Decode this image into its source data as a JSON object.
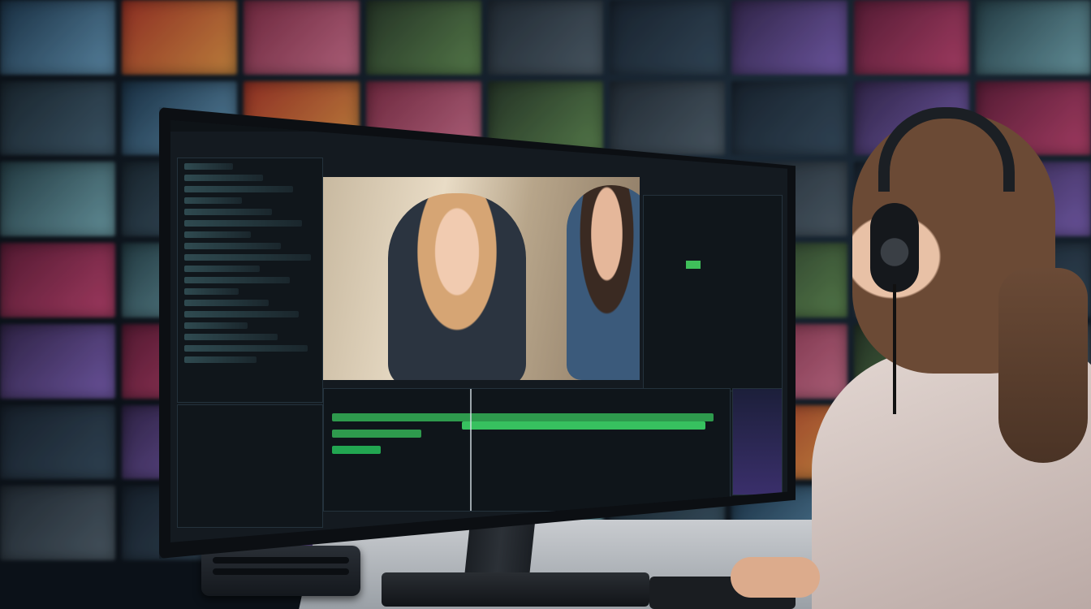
{
  "scene": {
    "description_type": "photo",
    "software_menu": [
      "",
      "",
      "",
      "",
      "",
      "",
      "",
      ""
    ]
  },
  "colors": {
    "timeline_track": "#2e9a4d",
    "scope_highlight": "#3fbf5a",
    "ui_background": "#141a20"
  },
  "icons": [
    "headphones-icon",
    "speaker-icon"
  ]
}
